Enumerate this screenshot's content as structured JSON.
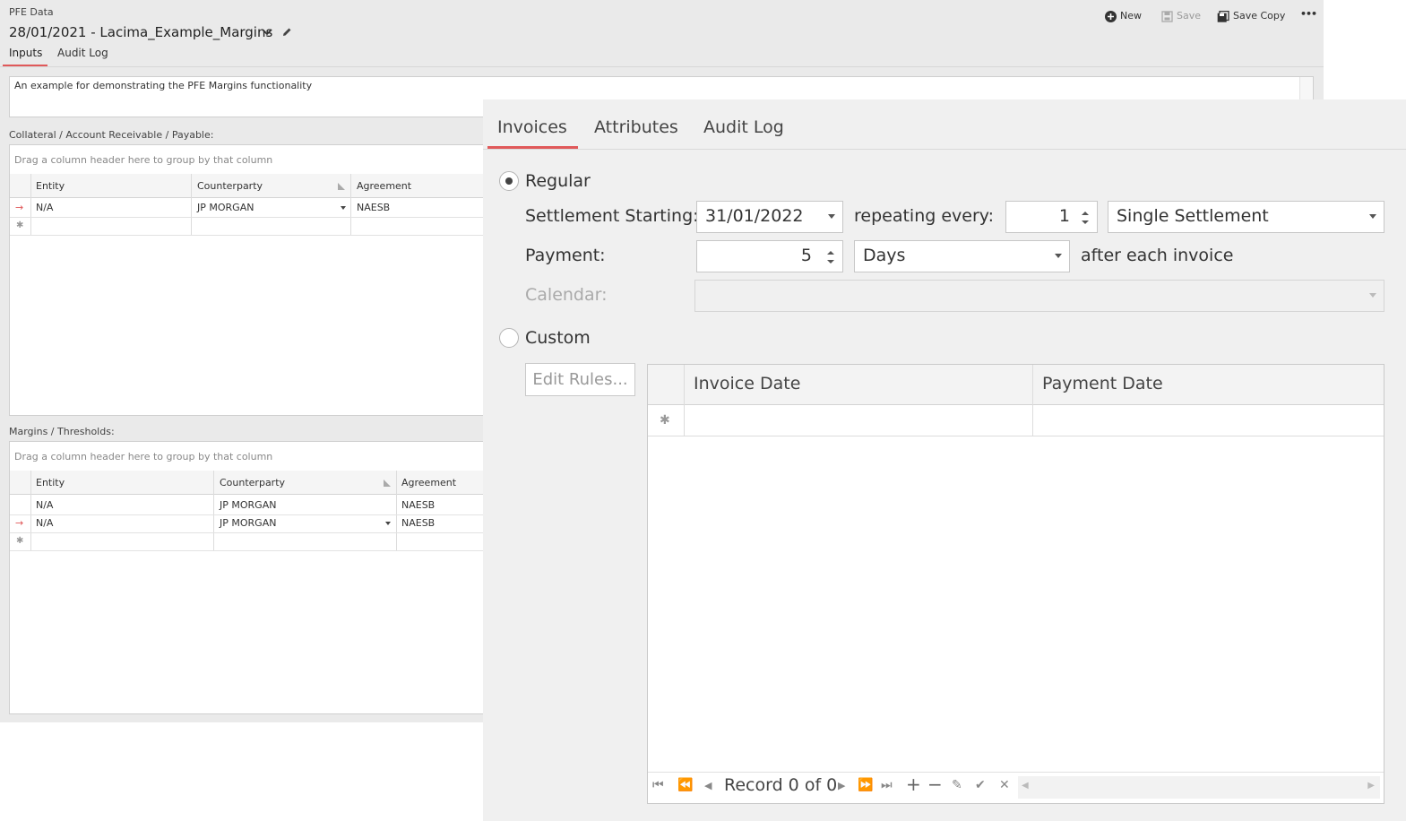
{
  "back_window": {
    "app_title": "PFE Data",
    "doc_title": "28/01/2021 - Lacima_Example_Margins",
    "title_dropdown_icon": "chevron-down-icon",
    "edit_icon": "pencil-icon",
    "tabs": [
      {
        "label": "Inputs",
        "active": true
      },
      {
        "label": "Audit Log",
        "active": false
      }
    ],
    "toolbar": {
      "new_label": "New",
      "save_label": "Save",
      "save_copy_label": "Save Copy",
      "more_label": "•••"
    },
    "description": "An example for demonstrating the PFE Margins functionality",
    "collateral": {
      "label": "Collateral / Account Receivable / Payable:",
      "group_hint": "Drag a column header here to group by that column",
      "columns": [
        "Entity",
        "Counterparty",
        "Agreement"
      ],
      "rows": [
        {
          "entity": "N/A",
          "counterparty": "JP MORGAN",
          "agreement": "NAESB",
          "current": true
        }
      ]
    },
    "margins": {
      "label": "Margins / Thresholds:",
      "group_hint": "Drag a column header here to group by that column",
      "columns": [
        "Entity",
        "Counterparty",
        "Agreement"
      ],
      "rows": [
        {
          "entity": "N/A",
          "counterparty": "JP MORGAN",
          "agreement": "NAESB",
          "current": false
        },
        {
          "entity": "N/A",
          "counterparty": "JP MORGAN",
          "agreement": "NAESB",
          "current": true
        }
      ]
    },
    "accent_color": "#e0595a"
  },
  "dialog": {
    "tabs": [
      {
        "label": "Invoices",
        "active": true
      },
      {
        "label": "Attributes",
        "active": false
      },
      {
        "label": "Audit Log",
        "active": false
      }
    ],
    "regular_label": "Regular",
    "regular_selected": true,
    "settlement_starting_label": "Settlement Starting:",
    "settlement_date": "31/01/2022",
    "repeating_every_label": "repeating every:",
    "repeating_value": "1",
    "settlement_type": "Single Settlement",
    "payment_label": "Payment:",
    "payment_value": "5",
    "payment_unit": "Days",
    "after_each_invoice_label": "after each invoice",
    "calendar_label": "Calendar:",
    "calendar_value": "",
    "custom_label": "Custom",
    "custom_selected": false,
    "edit_rules_label": "Edit Rules...",
    "invoice_grid": {
      "columns": [
        "Invoice Date",
        "Payment Date"
      ],
      "record_text": "Record 0 of 0"
    }
  }
}
